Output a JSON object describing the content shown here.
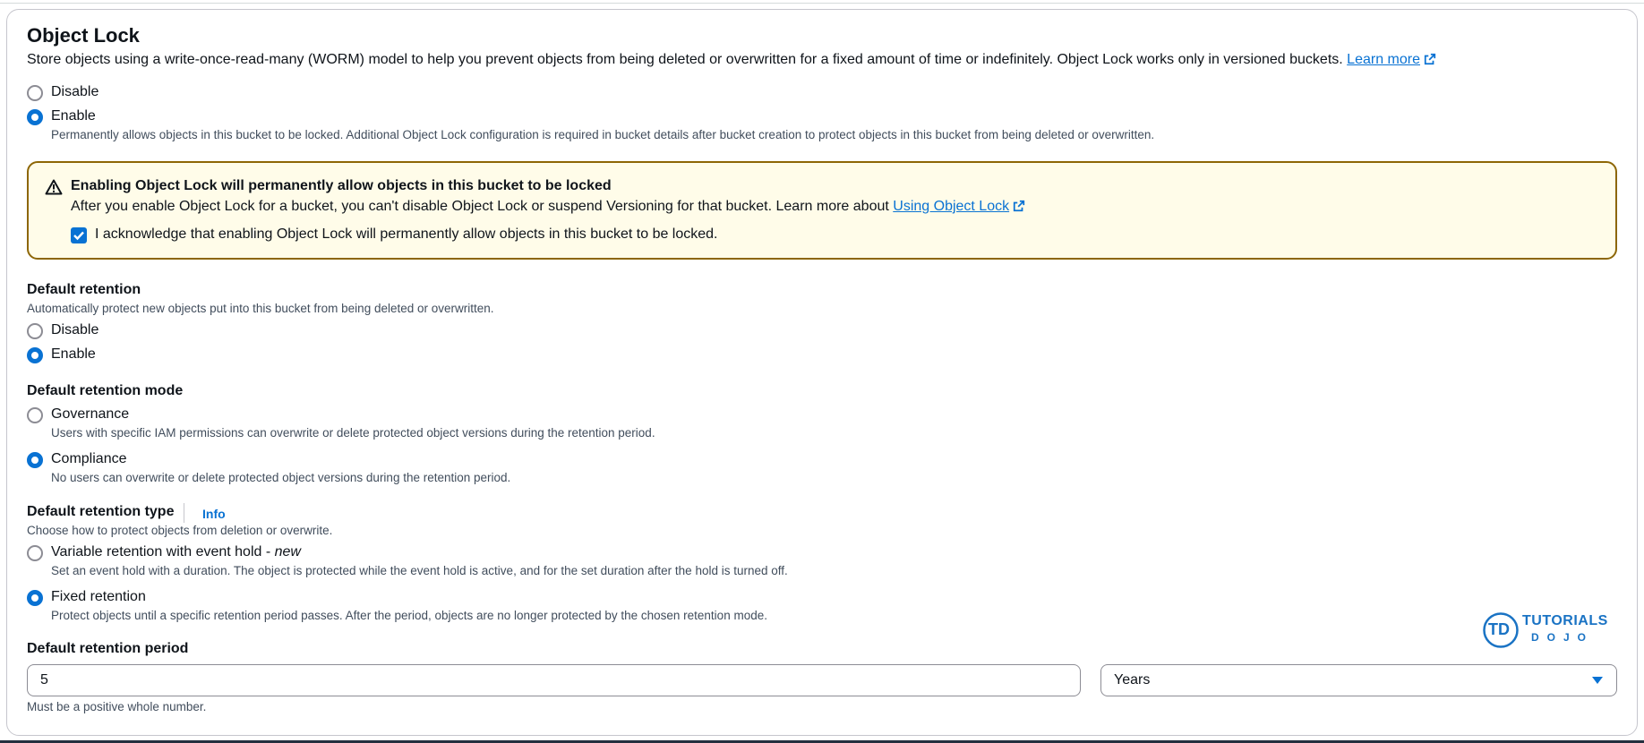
{
  "object_lock": {
    "title": "Object Lock",
    "description": "Store objects using a write-once-read-many (WORM) model to help you prevent objects from being deleted or overwritten for a fixed amount of time or indefinitely. Object Lock works only in versioned buckets.",
    "learn_more": "Learn more",
    "options": {
      "disable": "Disable",
      "enable": "Enable",
      "enable_desc": "Permanently allows objects in this bucket to be locked. Additional Object Lock configuration is required in bucket details after bucket creation to protect objects in this bucket from being deleted or overwritten."
    },
    "selected": "Enable"
  },
  "warning": {
    "title": "Enabling Object Lock will permanently allow objects in this bucket to be locked",
    "body": "After you enable Object Lock for a bucket, you can't disable Object Lock or suspend Versioning for that bucket. Learn more about",
    "link": "Using Object Lock",
    "acknowledge": "I acknowledge that enabling Object Lock will permanently allow objects in this bucket to be locked.",
    "acknowledged": true
  },
  "default_retention": {
    "label": "Default retention",
    "description": "Automatically protect new objects put into this bucket from being deleted or overwritten.",
    "disable": "Disable",
    "enable": "Enable",
    "selected": "Enable"
  },
  "retention_mode": {
    "label": "Default retention mode",
    "governance": "Governance",
    "governance_desc": "Users with specific IAM permissions can overwrite or delete protected object versions during the retention period.",
    "compliance": "Compliance",
    "compliance_desc": "No users can overwrite or delete protected object versions during the retention period.",
    "selected": "Compliance"
  },
  "retention_type": {
    "label": "Default retention type",
    "info": "Info",
    "description": "Choose how to protect objects from deletion or overwrite.",
    "variable": "Variable retention with event hold - ",
    "variable_new": "new",
    "variable_desc": "Set an event hold with a duration. The object is protected while the event hold is active, and for the set duration after the hold is turned off.",
    "fixed": "Fixed retention",
    "fixed_desc": "Protect objects until a specific retention period passes. After the period, objects are no longer protected by the chosen retention mode.",
    "selected": "Fixed retention"
  },
  "retention_period": {
    "label": "Default retention period",
    "value": "5",
    "unit": "Years",
    "hint": "Must be a positive whole number."
  },
  "watermark": {
    "icon_text": "TD",
    "brand": "TUTORIALS",
    "sub": "DOJO"
  },
  "colors": {
    "accent": "#0972d3",
    "warning_border": "#8d6605",
    "warning_bg": "#fffce9"
  }
}
